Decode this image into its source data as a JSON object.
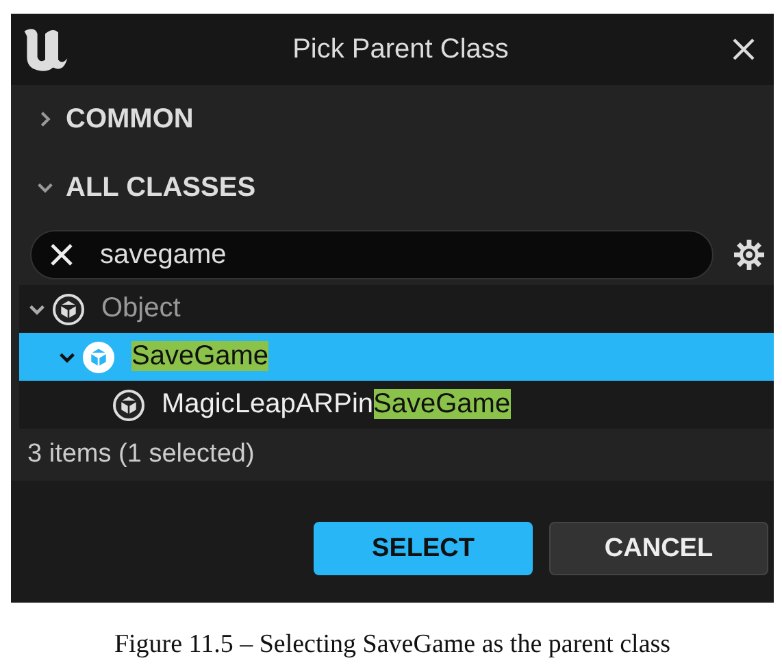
{
  "window": {
    "title": "Pick Parent Class"
  },
  "sections": [
    {
      "label": "COMMON",
      "expanded": false
    },
    {
      "label": "ALL CLASSES",
      "expanded": true
    }
  ],
  "search": {
    "value": "savegame"
  },
  "tree": [
    {
      "parts": [
        {
          "text": "Object",
          "match": false
        }
      ],
      "selected": false,
      "greyed": true,
      "expanded": true,
      "children": [
        {
          "parts": [
            {
              "text": "SaveGame",
              "match": true
            }
          ],
          "selected": true,
          "expanded": true,
          "children": [
            {
              "parts": [
                {
                  "text": "MagicLeapARPin",
                  "match": false
                },
                {
                  "text": "SaveGame",
                  "match": true
                }
              ],
              "selected": false
            }
          ]
        }
      ]
    }
  ],
  "status": "3 items (1 selected)",
  "buttons": [
    {
      "label": "SELECT",
      "kind": "primary"
    },
    {
      "label": "CANCEL",
      "kind": "secondary"
    }
  ],
  "caption": "Figure 11.5 – Selecting SaveGame as the parent class"
}
